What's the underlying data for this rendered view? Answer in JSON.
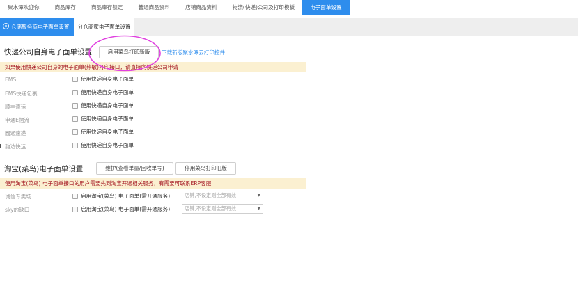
{
  "top_tabs": [
    {
      "label": "聚水潭欢迎你"
    },
    {
      "label": "商品库存"
    },
    {
      "label": "商品库存锁定"
    },
    {
      "label": "普通商品资料"
    },
    {
      "label": "店铺商品资料"
    },
    {
      "label": "物流(快递)公司及打印模板"
    },
    {
      "label": "电子面单设置"
    }
  ],
  "sub_tabs": [
    {
      "label": "仓储服务商电子面单设置"
    },
    {
      "label": "分仓商家电子面单设置"
    }
  ],
  "express": {
    "title": "快递公司自身电子面单设置",
    "cainiao_button": "启用菜鸟打印新版",
    "download_link": "下载新版聚水潭云打印控件",
    "notice": "如果使用快递公司自身的电子面单(热敏)打印接口，请直接向快递公司申请",
    "rows": [
      {
        "label": "EMS",
        "option": "使用快递自身电子面单"
      },
      {
        "label": "EMS快递包裹",
        "option": "使用快递自身电子面单"
      },
      {
        "label": "顺丰速运",
        "option": "使用快递自身电子面单"
      },
      {
        "label": "申通E物流",
        "option": "使用快递自身电子面单"
      },
      {
        "label": "圆通速递",
        "option": "使用快递自身电子面单"
      },
      {
        "label": "韵达快运",
        "option": "使用快递自身电子面单"
      }
    ]
  },
  "taobao": {
    "title": "淘宝(菜鸟)电子面单设置",
    "maintain_button": "维护(查看单量/回收单号)",
    "old_button": "停用菜鸟打印旧版",
    "notice": "使用淘宝(菜鸟) 电子面单接口的用户需要先到淘宝开通相关服务，有需要可联系ERP客服",
    "rows": [
      {
        "label": "诚信专卖场",
        "option": "启用淘宝(菜鸟) 电子面单(需开通服务)",
        "select": "店铺,不设定则全部有效"
      },
      {
        "label": "sky的缺口",
        "option": "启用淘宝(菜鸟) 电子面单(需开通服务)",
        "select": "店铺,不设定则全部有效"
      }
    ]
  },
  "colors": {
    "accent": "#2e8ded",
    "notice_bg": "#fbf0d1",
    "notice_text": "#a3141f",
    "annotation": "#e040e0"
  }
}
